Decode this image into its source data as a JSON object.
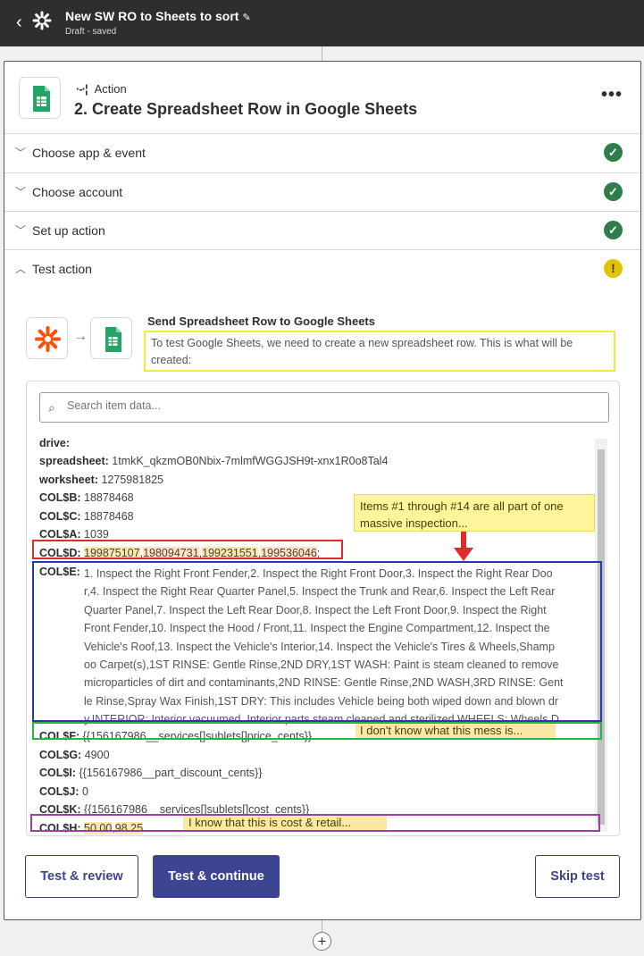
{
  "header": {
    "back_icon": "chevron-left-icon",
    "logo_icon": "zapier-asterisk-icon",
    "title": "New SW RO to Sheets to sort",
    "edit_icon": "pencil-icon",
    "status": "Draft - saved"
  },
  "step": {
    "type_label": "Action",
    "title": "2. Create Spreadsheet Row in Google Sheets",
    "app_icon": "google-sheets-icon",
    "more_icon": "more-horizontal-icon"
  },
  "sections": [
    {
      "label": "Choose app & event",
      "status": "complete"
    },
    {
      "label": "Choose account",
      "status": "complete"
    },
    {
      "label": "Set up action",
      "status": "complete"
    },
    {
      "label": "Test action",
      "status": "warning"
    }
  ],
  "test": {
    "title": "Send Spreadsheet Row to Google Sheets",
    "description": "To test Google Sheets, we need to create a new spreadsheet row. This is what will be created:",
    "search_placeholder": "Search item data..."
  },
  "fields": {
    "drive": {
      "label": "drive:"
    },
    "spreadsheet": {
      "label": "spreadsheet:",
      "value": "1tmkK_qkzmOB0Nbix-7mlmfWGGJSH9t-xnx1R0o8Tal4"
    },
    "worksheet": {
      "label": "worksheet:",
      "value": "1275981825"
    },
    "colb": {
      "label": "COL$B:",
      "value": "18878468"
    },
    "colc": {
      "label": "COL$C:",
      "value": "18878468"
    },
    "cola": {
      "label": "COL$A:",
      "value": "1039"
    },
    "cold": {
      "label": "COL$D:",
      "values": [
        "199875107",
        "198094731",
        "199231551",
        "199536046"
      ],
      "trailing": ";"
    },
    "cole": {
      "label": "COL$E:",
      "lines": [
        "1. Inspect the Right Front Fender,2. Inspect the Right Front Door,3. Inspect the Right Rear Doo",
        "r,4. Inspect the Right Rear Quarter Panel,5. Inspect the Trunk and Rear,6. Inspect the Left Rear",
        "Quarter Panel,7. Inspect the Left Rear Door,8. Inspect the Left Front Door,9. Inspect the Right",
        "Front Fender,10. Inspect the Hood / Front,11. Inspect the Engine Compartment,12. Inspect the",
        "Vehicle's Roof,13. Inspect the Vehicle's Interior,14. Inspect the Vehicle's Tires & Wheels,Shamp",
        "oo Carpet(s),1ST RINSE: Gentle Rinse,2ND DRY,1ST WASH: Paint is steam cleaned to remove",
        "microparticles of dirt and contaminants,2ND RINSE: Gentle Rinse,2ND WASH,3RD RINSE: Gent",
        "le Rinse,Spray Wax Finish,1ST DRY: This includes Vehicle being both wiped down and blown dr",
        "y.INTERIOR: Interior vacuumed. Interior parts steam cleaned and sterilized.WHEELS: Wheels D"
      ]
    },
    "colf": {
      "label": "COL$F:",
      "value": "{{156167986__services[]sublets[]price_cents}}"
    },
    "colg": {
      "label": "COL$G:",
      "value": "4900"
    },
    "coli": {
      "label": "COL$I:",
      "value": "{{156167986__part_discount_cents}}"
    },
    "colj": {
      "label": "COL$J:",
      "value": "0"
    },
    "colk": {
      "label": "COL$K:",
      "value": "{{156167986__services[]sublets[]cost_cents}}"
    },
    "colh": {
      "label": "COL$H:",
      "values": [
        "50.00",
        "98.25"
      ]
    }
  },
  "annotations": {
    "items_note": "Items #1 through #14 are all part of one massive inspection...",
    "mess_note": "I don't know what this mess is...",
    "cost_note": "I know that this is cost & retail...",
    "colors": {
      "red": "#e02b2b",
      "blue": "#2a39a6",
      "green": "#2bb24c",
      "purple": "#9b3fa3",
      "yellow": "#f4ea3a"
    }
  },
  "buttons": {
    "test_review": "Test & review",
    "test_continue": "Test & continue",
    "skip": "Skip test"
  },
  "colors": {
    "brand_primary": "#3d4592",
    "success": "#2e7d4a",
    "warning": "#e0c400",
    "topbar": "#2d2e2e"
  }
}
